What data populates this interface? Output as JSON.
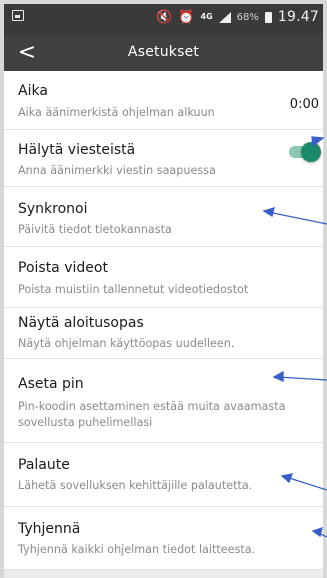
{
  "status_bar": {
    "icons": [
      "gallery-icon",
      "mute-icon",
      "alarm-icon",
      "signal-icon",
      "battery-icon"
    ],
    "network": "4G",
    "battery": "68%",
    "time": "19.47"
  },
  "header": {
    "back": "<",
    "title": "Asetukset"
  },
  "settings": [
    {
      "title": "Aika",
      "description": "Aika äänimerkistä ohjelman alkuun",
      "value": "0:00"
    },
    {
      "title": "Hälytä viesteistä",
      "description": "Anna äänimerkki viestin saapuessa",
      "toggle_on": true
    },
    {
      "title": "Synkronoi",
      "description": "Päivitä tiedot tietokannasta"
    },
    {
      "title": "Poista videot",
      "description": "Poista muistiin tallennetut videotiedostot"
    },
    {
      "title": "Näytä aloitusopas",
      "description": "Näytä ohjelman käyttöopas uudelleen."
    },
    {
      "title": "Aseta pin",
      "description": "Pin-koodin asettaminen estää muita avaamasta sovellusta puhelimellasi"
    },
    {
      "title": "Palaute",
      "description": "Lähetä sovelluksen kehittäjille palautetta."
    },
    {
      "title": "Tyhjennä",
      "description": "Tyhjennä kaikki ohjelman tiedot laitteesta."
    }
  ],
  "colors": {
    "status_bar": "#3a3a3a",
    "app_bar": "#404040",
    "toggle_accent": "#1a8a6a",
    "annotation_arrow": "#3a5fc8"
  }
}
